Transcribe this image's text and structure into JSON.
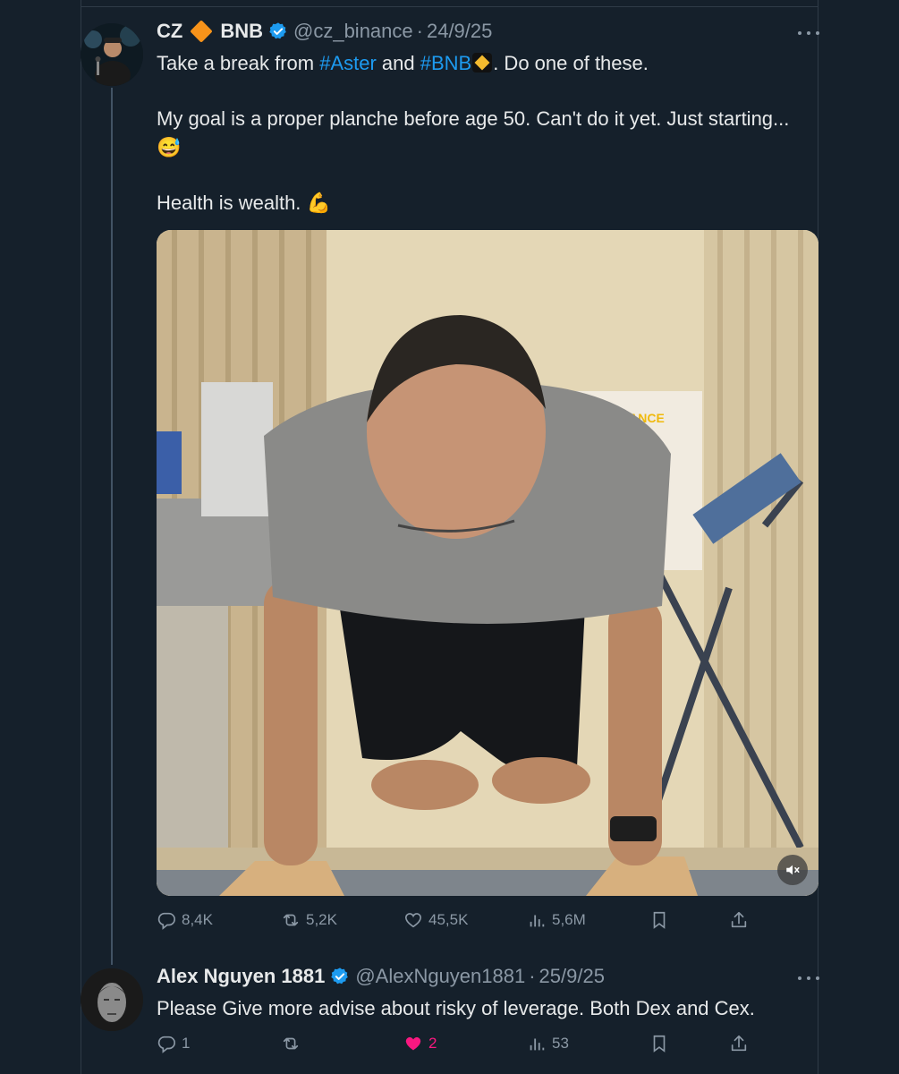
{
  "post": {
    "author_name_first": "CZ",
    "author_name_second": "BNB",
    "handle": "@cz_binance",
    "separator": "·",
    "date": "24/9/25",
    "line1_before": "Take a break from ",
    "hashtag1": "#Aster",
    "line1_mid": " and ",
    "hashtag2": "#BNB",
    "line1_after": ". Do one of these.",
    "line2": "My goal is a proper planche before age 50. Can't do it yet. Just starting...",
    "emoji_sweat": "😅",
    "line3": "Health is wealth. ",
    "emoji_muscle": "💪",
    "video_brand_text": "BINANCE",
    "stats": {
      "replies": "8,4K",
      "reposts": "5,2K",
      "likes": "45,5K",
      "views": "5,6M"
    }
  },
  "reply": {
    "author_name": "Alex Nguyen 1881",
    "handle": "@AlexNguyen1881",
    "separator": "·",
    "date": "25/9/25",
    "text": "Please Give more advise about risky of leverage. Both Dex and Cex.",
    "stats": {
      "replies": "1",
      "likes": "2",
      "views": "53"
    }
  },
  "colors": {
    "background": "#15202b",
    "accent": "#1d9bf0",
    "like_active": "#f91880",
    "muted": "#8b98a5"
  },
  "icons": [
    "verified-badge-icon",
    "orange-diamond-icon",
    "bnb-emoji-icon",
    "more-icon",
    "reply-icon",
    "repost-icon",
    "like-icon",
    "views-icon",
    "bookmark-icon",
    "share-icon",
    "mute-icon"
  ]
}
